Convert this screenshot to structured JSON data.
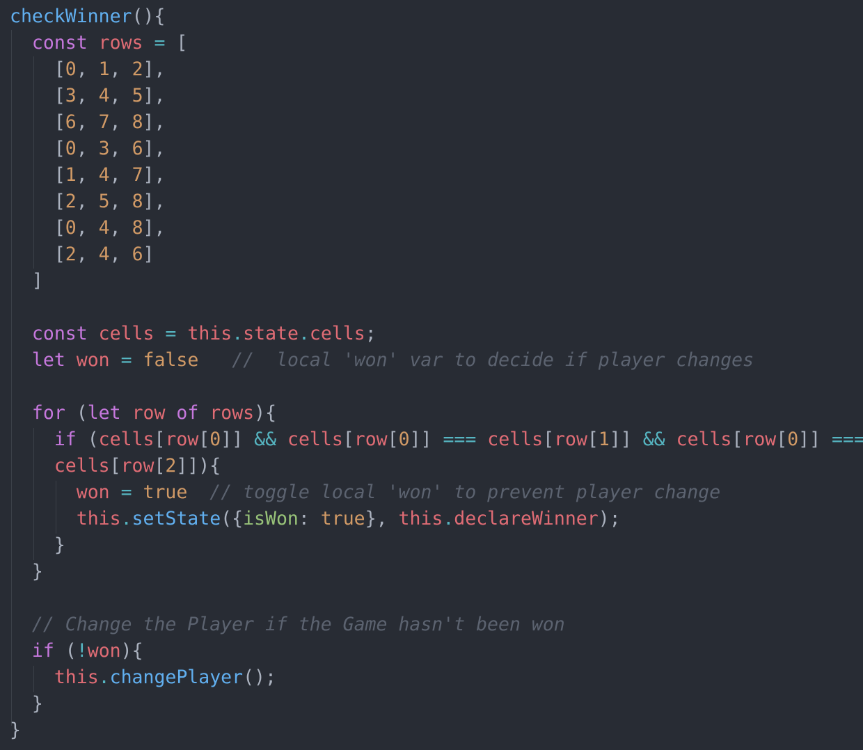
{
  "editor": {
    "theme_colors": {
      "background": "#282c34",
      "keyword": "#c678dd",
      "variable": "#e06c75",
      "function": "#61afef",
      "number": "#d19a66",
      "operator": "#56b6c2",
      "comment": "#5c6370",
      "property": "#98c379",
      "plain": "#abb2bf"
    },
    "lines": [
      [
        {
          "t": "func",
          "v": "checkWinner"
        },
        {
          "t": "punct",
          "v": "(){"
        }
      ],
      [
        {
          "t": "punct",
          "v": "  "
        },
        {
          "t": "keyword",
          "v": "const"
        },
        {
          "t": "punct",
          "v": " "
        },
        {
          "t": "var",
          "v": "rows"
        },
        {
          "t": "punct",
          "v": " "
        },
        {
          "t": "op",
          "v": "="
        },
        {
          "t": "punct",
          "v": " ["
        }
      ],
      [
        {
          "t": "punct",
          "v": "    ["
        },
        {
          "t": "num",
          "v": "0"
        },
        {
          "t": "punct",
          "v": ", "
        },
        {
          "t": "num",
          "v": "1"
        },
        {
          "t": "punct",
          "v": ", "
        },
        {
          "t": "num",
          "v": "2"
        },
        {
          "t": "punct",
          "v": "],"
        }
      ],
      [
        {
          "t": "punct",
          "v": "    ["
        },
        {
          "t": "num",
          "v": "3"
        },
        {
          "t": "punct",
          "v": ", "
        },
        {
          "t": "num",
          "v": "4"
        },
        {
          "t": "punct",
          "v": ", "
        },
        {
          "t": "num",
          "v": "5"
        },
        {
          "t": "punct",
          "v": "],"
        }
      ],
      [
        {
          "t": "punct",
          "v": "    ["
        },
        {
          "t": "num",
          "v": "6"
        },
        {
          "t": "punct",
          "v": ", "
        },
        {
          "t": "num",
          "v": "7"
        },
        {
          "t": "punct",
          "v": ", "
        },
        {
          "t": "num",
          "v": "8"
        },
        {
          "t": "punct",
          "v": "],"
        }
      ],
      [
        {
          "t": "punct",
          "v": "    ["
        },
        {
          "t": "num",
          "v": "0"
        },
        {
          "t": "punct",
          "v": ", "
        },
        {
          "t": "num",
          "v": "3"
        },
        {
          "t": "punct",
          "v": ", "
        },
        {
          "t": "num",
          "v": "6"
        },
        {
          "t": "punct",
          "v": "],"
        }
      ],
      [
        {
          "t": "punct",
          "v": "    ["
        },
        {
          "t": "num",
          "v": "1"
        },
        {
          "t": "punct",
          "v": ", "
        },
        {
          "t": "num",
          "v": "4"
        },
        {
          "t": "punct",
          "v": ", "
        },
        {
          "t": "num",
          "v": "7"
        },
        {
          "t": "punct",
          "v": "],"
        }
      ],
      [
        {
          "t": "punct",
          "v": "    ["
        },
        {
          "t": "num",
          "v": "2"
        },
        {
          "t": "punct",
          "v": ", "
        },
        {
          "t": "num",
          "v": "5"
        },
        {
          "t": "punct",
          "v": ", "
        },
        {
          "t": "num",
          "v": "8"
        },
        {
          "t": "punct",
          "v": "],"
        }
      ],
      [
        {
          "t": "punct",
          "v": "    ["
        },
        {
          "t": "num",
          "v": "0"
        },
        {
          "t": "punct",
          "v": ", "
        },
        {
          "t": "num",
          "v": "4"
        },
        {
          "t": "punct",
          "v": ", "
        },
        {
          "t": "num",
          "v": "8"
        },
        {
          "t": "punct",
          "v": "],"
        }
      ],
      [
        {
          "t": "punct",
          "v": "    ["
        },
        {
          "t": "num",
          "v": "2"
        },
        {
          "t": "punct",
          "v": ", "
        },
        {
          "t": "num",
          "v": "4"
        },
        {
          "t": "punct",
          "v": ", "
        },
        {
          "t": "num",
          "v": "6"
        },
        {
          "t": "punct",
          "v": "]"
        }
      ],
      [
        {
          "t": "punct",
          "v": "  ]"
        }
      ],
      [],
      [
        {
          "t": "punct",
          "v": "  "
        },
        {
          "t": "keyword",
          "v": "const"
        },
        {
          "t": "punct",
          "v": " "
        },
        {
          "t": "var",
          "v": "cells"
        },
        {
          "t": "punct",
          "v": " "
        },
        {
          "t": "op",
          "v": "="
        },
        {
          "t": "punct",
          "v": " "
        },
        {
          "t": "var",
          "v": "this"
        },
        {
          "t": "op",
          "v": "."
        },
        {
          "t": "var",
          "v": "state"
        },
        {
          "t": "op",
          "v": "."
        },
        {
          "t": "var",
          "v": "cells"
        },
        {
          "t": "punct",
          "v": ";"
        }
      ],
      [
        {
          "t": "punct",
          "v": "  "
        },
        {
          "t": "keyword",
          "v": "let"
        },
        {
          "t": "punct",
          "v": " "
        },
        {
          "t": "var",
          "v": "won"
        },
        {
          "t": "punct",
          "v": " "
        },
        {
          "t": "op",
          "v": "="
        },
        {
          "t": "punct",
          "v": " "
        },
        {
          "t": "bool",
          "v": "false"
        },
        {
          "t": "punct",
          "v": "   "
        },
        {
          "t": "comment",
          "v": "//  local 'won' var to decide if player changes"
        }
      ],
      [],
      [
        {
          "t": "punct",
          "v": "  "
        },
        {
          "t": "keyword",
          "v": "for"
        },
        {
          "t": "punct",
          "v": " ("
        },
        {
          "t": "keyword",
          "v": "let"
        },
        {
          "t": "punct",
          "v": " "
        },
        {
          "t": "var",
          "v": "row"
        },
        {
          "t": "punct",
          "v": " "
        },
        {
          "t": "keyword",
          "v": "of"
        },
        {
          "t": "punct",
          "v": " "
        },
        {
          "t": "var",
          "v": "rows"
        },
        {
          "t": "punct",
          "v": "){"
        }
      ],
      [
        {
          "t": "punct",
          "v": "    "
        },
        {
          "t": "keyword",
          "v": "if"
        },
        {
          "t": "punct",
          "v": " ("
        },
        {
          "t": "var",
          "v": "cells"
        },
        {
          "t": "punct",
          "v": "["
        },
        {
          "t": "var",
          "v": "row"
        },
        {
          "t": "punct",
          "v": "["
        },
        {
          "t": "num",
          "v": "0"
        },
        {
          "t": "punct",
          "v": "]] "
        },
        {
          "t": "op",
          "v": "&&"
        },
        {
          "t": "punct",
          "v": " "
        },
        {
          "t": "var",
          "v": "cells"
        },
        {
          "t": "punct",
          "v": "["
        },
        {
          "t": "var",
          "v": "row"
        },
        {
          "t": "punct",
          "v": "["
        },
        {
          "t": "num",
          "v": "0"
        },
        {
          "t": "punct",
          "v": "]] "
        },
        {
          "t": "op",
          "v": "==="
        },
        {
          "t": "punct",
          "v": " "
        },
        {
          "t": "var",
          "v": "cells"
        },
        {
          "t": "punct",
          "v": "["
        },
        {
          "t": "var",
          "v": "row"
        },
        {
          "t": "punct",
          "v": "["
        },
        {
          "t": "num",
          "v": "1"
        },
        {
          "t": "punct",
          "v": "]] "
        },
        {
          "t": "op",
          "v": "&&"
        },
        {
          "t": "punct",
          "v": " "
        },
        {
          "t": "var",
          "v": "cells"
        },
        {
          "t": "punct",
          "v": "["
        },
        {
          "t": "var",
          "v": "row"
        },
        {
          "t": "punct",
          "v": "["
        },
        {
          "t": "num",
          "v": "0"
        },
        {
          "t": "punct",
          "v": "]] "
        },
        {
          "t": "op",
          "v": "==="
        }
      ],
      [
        {
          "t": "punct",
          "v": "    "
        },
        {
          "t": "var",
          "v": "cells"
        },
        {
          "t": "punct",
          "v": "["
        },
        {
          "t": "var",
          "v": "row"
        },
        {
          "t": "punct",
          "v": "["
        },
        {
          "t": "num",
          "v": "2"
        },
        {
          "t": "punct",
          "v": "]]){"
        }
      ],
      [
        {
          "t": "punct",
          "v": "      "
        },
        {
          "t": "var",
          "v": "won"
        },
        {
          "t": "punct",
          "v": " "
        },
        {
          "t": "op",
          "v": "="
        },
        {
          "t": "punct",
          "v": " "
        },
        {
          "t": "bool",
          "v": "true"
        },
        {
          "t": "punct",
          "v": "  "
        },
        {
          "t": "comment",
          "v": "// toggle local 'won' to prevent player change"
        }
      ],
      [
        {
          "t": "punct",
          "v": "      "
        },
        {
          "t": "var",
          "v": "this"
        },
        {
          "t": "op",
          "v": "."
        },
        {
          "t": "func",
          "v": "setState"
        },
        {
          "t": "punct",
          "v": "({"
        },
        {
          "t": "prop",
          "v": "isWon"
        },
        {
          "t": "punct",
          "v": ": "
        },
        {
          "t": "bool",
          "v": "true"
        },
        {
          "t": "punct",
          "v": "}, "
        },
        {
          "t": "var",
          "v": "this"
        },
        {
          "t": "op",
          "v": "."
        },
        {
          "t": "var",
          "v": "declareWinner"
        },
        {
          "t": "punct",
          "v": ");"
        }
      ],
      [
        {
          "t": "punct",
          "v": "    }"
        }
      ],
      [
        {
          "t": "punct",
          "v": "  }"
        }
      ],
      [],
      [
        {
          "t": "punct",
          "v": "  "
        },
        {
          "t": "comment",
          "v": "// Change the Player if the Game hasn't been won"
        }
      ],
      [
        {
          "t": "punct",
          "v": "  "
        },
        {
          "t": "keyword",
          "v": "if"
        },
        {
          "t": "punct",
          "v": " ("
        },
        {
          "t": "op",
          "v": "!"
        },
        {
          "t": "var",
          "v": "won"
        },
        {
          "t": "punct",
          "v": "){"
        }
      ],
      [
        {
          "t": "punct",
          "v": "    "
        },
        {
          "t": "var",
          "v": "this"
        },
        {
          "t": "op",
          "v": "."
        },
        {
          "t": "func",
          "v": "changePlayer"
        },
        {
          "t": "punct",
          "v": "();"
        }
      ],
      [
        {
          "t": "punct",
          "v": "  }"
        }
      ],
      [
        {
          "t": "punct",
          "v": "}"
        }
      ]
    ]
  }
}
